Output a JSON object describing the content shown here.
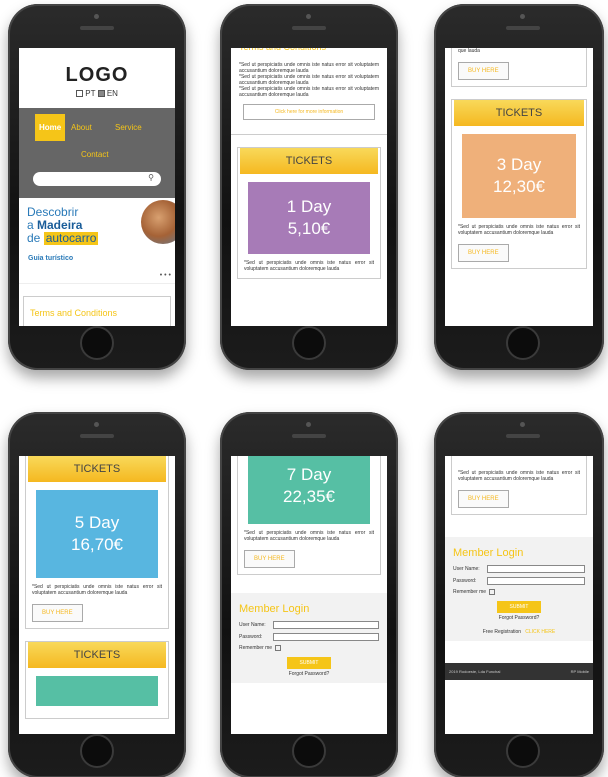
{
  "header": {
    "logo": "LOGO",
    "lang_pt": "PT",
    "lang_en": "EN"
  },
  "nav": {
    "home": "Home",
    "about": "About",
    "service": "Service",
    "contact": "Contact"
  },
  "banner": {
    "line1": "Descobrir",
    "line2_a": "a ",
    "line2_b": "Madeira",
    "line3_a": "de ",
    "line3_b": "autocarro",
    "guide": "Guia turístico"
  },
  "terms": {
    "title": "Terms and Conditions",
    "more_info": "Click here for more information"
  },
  "lorem": "*Sed ut perspiciatis unde omnis iste natus error sit voluptatem accusantium doloremque lauda",
  "lorem_short": "que lauda",
  "tickets": {
    "heading": "TICKETS",
    "buy_label": "BUY HERE",
    "items": [
      {
        "days": "1 Day",
        "price": "5,10€",
        "color": "#a77bb7"
      },
      {
        "days": "3 Day",
        "price": "12,30€",
        "color": "#efb07a"
      },
      {
        "days": "5 Day",
        "price": "16,70€",
        "color": "#58b6e0"
      },
      {
        "days": "7 Day",
        "price": "22,35€",
        "color": "#56bfa4"
      }
    ]
  },
  "login": {
    "title": "Member Login",
    "username_label": "User Name:",
    "password_label": "Password:",
    "remember_label": "Remember me",
    "submit_label": "SUBMIT",
    "forgot_label": "Forgot Password?",
    "free_registration": "Free Registration",
    "click_here": "CLICK HERE"
  },
  "footer": {
    "left": "2019 Rodoeste, Lda Funchal",
    "right": "RP Mobile"
  },
  "colors": {
    "accent": "#f5c518",
    "nav_bg": "#666666"
  }
}
